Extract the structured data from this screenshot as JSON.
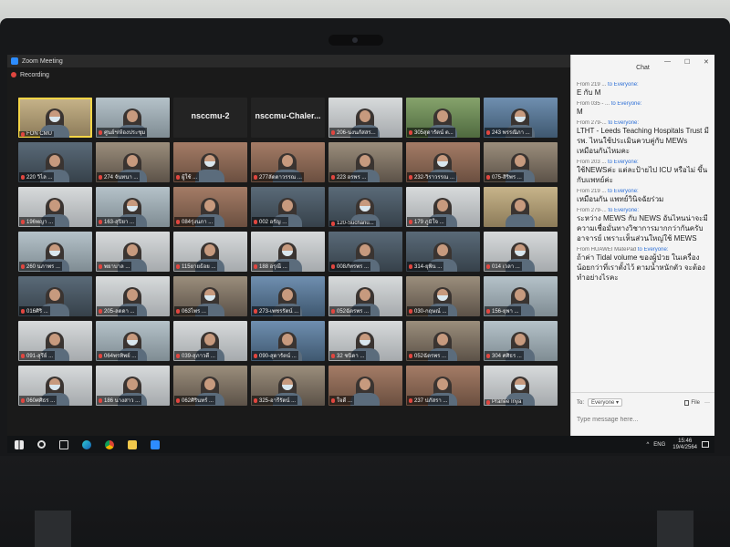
{
  "window": {
    "title": "Zoom Meeting",
    "recording_label": "Recording"
  },
  "gallery": [
    {
      "label": "FON CMU",
      "big": "",
      "bg": "bg0",
      "active": true
    },
    {
      "label": "ศูนย์ฯ/ห้องประชุม",
      "big": "",
      "bg": "bg1"
    },
    {
      "label": "",
      "big": "nsccmu-2",
      "bg": ""
    },
    {
      "label": "",
      "big": "nsccmu-Chaler...",
      "bg": ""
    },
    {
      "label": "206-นงนภัสสร...",
      "big": "",
      "bg": "bg3"
    },
    {
      "label": "305สุดารัตน์ ต...",
      "big": "",
      "bg": "bg6"
    },
    {
      "label": "243 พรรณิภา ...",
      "big": "",
      "bg": "bg5"
    },
    {
      "label": "220 วิไล ...",
      "big": "",
      "bg": "bg2"
    },
    {
      "label": "274 จันทนา ...",
      "big": "",
      "bg": "bg4"
    },
    {
      "label": "ผู้ใช้ ...",
      "big": "",
      "bg": "bg7"
    },
    {
      "label": "277ลัดดาวรรณ ...",
      "big": "",
      "bg": "bg7"
    },
    {
      "label": "223 อรพร ...",
      "big": "",
      "bg": "bg4"
    },
    {
      "label": "232-วิราวรรณ ...",
      "big": "",
      "bg": "bg7"
    },
    {
      "label": "075-สิริพร ...",
      "big": "",
      "bg": "bg4"
    },
    {
      "label": "196พญา ...",
      "big": "",
      "bg": "bg3"
    },
    {
      "label": "163-สุปิยา ...",
      "big": "",
      "bg": "bg1"
    },
    {
      "label": "084รุ่งนภา ...",
      "big": "",
      "bg": "bg7"
    },
    {
      "label": "002 อรัญ ...",
      "big": "",
      "bg": "bg2"
    },
    {
      "label": "120-Suchanu...",
      "big": "",
      "bg": "bg2"
    },
    {
      "label": "179 ภูมิใจ ...",
      "big": "",
      "bg": "bg3"
    },
    {
      "label": "",
      "big": "",
      "bg": "bg0"
    },
    {
      "label": "260 นภาพร ...",
      "big": "",
      "bg": "bg1"
    },
    {
      "label": "พยาบาล ...",
      "big": "",
      "bg": "bg3"
    },
    {
      "label": "115ยายธ้อย ...",
      "big": "",
      "bg": "bg3"
    },
    {
      "label": "188 อรุณี ...",
      "big": "",
      "bg": "bg3"
    },
    {
      "label": "008ภัทรพร ...",
      "big": "",
      "bg": "bg2"
    },
    {
      "label": "314-ยุพิน ...",
      "big": "",
      "bg": "bg2"
    },
    {
      "label": "014 เวลา ...",
      "big": "",
      "bg": "bg3"
    },
    {
      "label": "016ศิริ ...",
      "big": "",
      "bg": "bg2"
    },
    {
      "label": "205-ลดดา ...",
      "big": "",
      "bg": "bg3"
    },
    {
      "label": "063ไพร ...",
      "big": "",
      "bg": "bg4"
    },
    {
      "label": "273-เพชรรัตน์ ...",
      "big": "",
      "bg": "bg5"
    },
    {
      "label": "052ฉัตรพร ...",
      "big": "",
      "bg": "bg3"
    },
    {
      "label": "030-กฤษณ์ ...",
      "big": "",
      "bg": "bg4"
    },
    {
      "label": "156-ยุพา ...",
      "big": "",
      "bg": "bg1"
    },
    {
      "label": "091-สุรีย์ ...",
      "big": "",
      "bg": "bg3"
    },
    {
      "label": "064พรทิพย์ ...",
      "big": "",
      "bg": "bg1"
    },
    {
      "label": "039-สุภาวดี ...",
      "big": "",
      "bg": "bg3"
    },
    {
      "label": "090-สุดารัตน์ ...",
      "big": "",
      "bg": "bg5"
    },
    {
      "label": "32 ชนิดา ...",
      "big": "",
      "bg": "bg3"
    },
    {
      "label": "052ฉัตรพร ...",
      "big": "",
      "bg": "bg4"
    },
    {
      "label": "304 ศศิธร ...",
      "big": "",
      "bg": "bg1"
    },
    {
      "label": "060ศศิธร ...",
      "big": "",
      "bg": "bg3"
    },
    {
      "label": "186 นางสาว ...",
      "big": "",
      "bg": "bg3"
    },
    {
      "label": "062ศิรินทร์ ...",
      "big": "",
      "bg": "bg4"
    },
    {
      "label": "325-อารีรัตน์ ...",
      "big": "",
      "bg": "bg4"
    },
    {
      "label": "ใจดี ...",
      "big": "",
      "bg": "bg7"
    },
    {
      "label": "237 ปภัสรา ...",
      "big": "",
      "bg": "bg7"
    },
    {
      "label": "Pranee Inya",
      "big": "",
      "bg": "bg3"
    }
  ],
  "chat": {
    "title": "Chat",
    "win_min": "—",
    "win_max": "☐",
    "win_close": "✕",
    "messages": [
      {
        "from": "From 219 ...",
        "to": "to Everyone:",
        "text": "E กับ M"
      },
      {
        "from": "From 035 - ...",
        "to": "to Everyone:",
        "text": "M"
      },
      {
        "from": "From 279-...",
        "to": "to Everyone:",
        "text": "LTHT - Leeds Teaching Hospitals Trust มี รพ. ไหนใช้ประเมินควบคู่กับ MEWs เหมือนกันไหมคะ"
      },
      {
        "from": "From 203 ...",
        "to": "to Everyone:",
        "text": "ใช้NEWSค่ะ แต่ละป้ายไป ICU หรือไม่ ขึ้นกับแพทย์ค่ะ"
      },
      {
        "from": "From 219 ...",
        "to": "to Everyone:",
        "text": "เหมือนกัน แพทย์วินิจฉัยร่วม"
      },
      {
        "from": "From 279-...",
        "to": "to Everyone:",
        "text": "ระหว่าง MEWS กับ NEWS อันไหนน่าจะมีความเชื่อมั่นทางวิชาการมากกว่ากันครับอาจารย์ เพราะเห็นส่วนใหญ่ใช้ MEWS"
      },
      {
        "from": "From HUAWEI MatePad",
        "to": "to Everyone:",
        "text": "ถ้าค่า Tidal volume ของผู้ป่วย ในเครื่อง น้อยกว่าที่เราตั้งไว้ ตามน้ำหนักตัว จะต้องทำอย่างไรคะ"
      }
    ],
    "to_label": "To:",
    "recipient": "Everyone ▾",
    "file_label": "File",
    "more": "···",
    "input_placeholder": "Type message here..."
  },
  "taskbar": {
    "clock_time": "15:46",
    "clock_date": "19/4/2564",
    "lang": "ENG",
    "tray_chevron": "^"
  }
}
